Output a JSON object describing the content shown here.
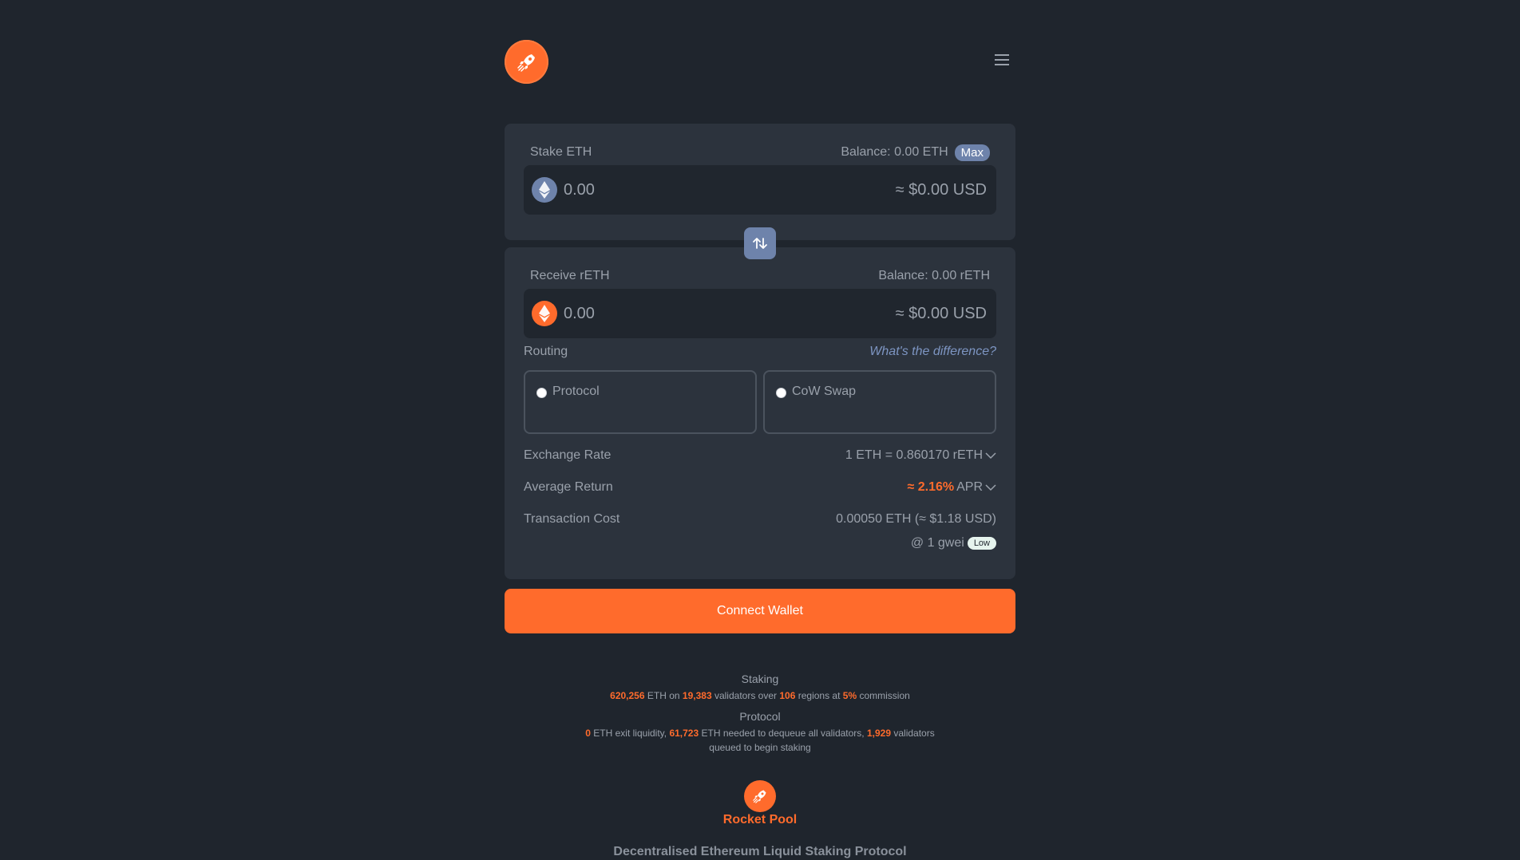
{
  "colors": {
    "background": "#1f252d",
    "card": "#2c333d",
    "accent": "#ff6b2c",
    "eth_blue": "#6e83ab",
    "link": "#7d95c2"
  },
  "header": {
    "logo_icon": "rocket-icon",
    "menu_icon": "hamburger-icon"
  },
  "stake": {
    "label": "Stake ETH",
    "balance": "Balance: 0.00 ETH",
    "max_label": "Max",
    "amount_placeholder": "0.00",
    "usd": "≈ $0.00 USD",
    "coin_icon": "eth-icon"
  },
  "swap": {
    "icon": "swap-arrows-icon"
  },
  "receive": {
    "label": "Receive rETH",
    "balance": "Balance: 0.00 rETH",
    "amount_placeholder": "0.00",
    "usd": "≈ $0.00 USD",
    "coin_icon": "reth-icon"
  },
  "routing": {
    "label": "Routing",
    "link": "What's the difference?",
    "options": [
      {
        "label": "Protocol"
      },
      {
        "label": "CoW Swap"
      }
    ]
  },
  "details": {
    "exchange_rate": {
      "label": "Exchange Rate",
      "value": "1 ETH = 0.860170 rETH"
    },
    "average_return": {
      "label": "Average Return",
      "value_accent": "≈ 2.16%",
      "value_suffix": "APR"
    },
    "transaction_cost": {
      "label": "Transaction Cost",
      "value": "0.00050 ETH (≈ $1.18 USD)"
    },
    "gas": {
      "value": "@ 1 gwei",
      "badge": "Low"
    }
  },
  "connect_button": "Connect Wallet",
  "staking_stats": {
    "title": "Staking",
    "eth": "620,256",
    "t1": "ETH on",
    "validators": "19,383",
    "t2": "validators over",
    "regions": "106",
    "t3": "regions at",
    "commission": "5%",
    "t4": "commission"
  },
  "protocol_stats": {
    "title": "Protocol",
    "exit_liquidity": "0",
    "t1": "ETH exit liquidity,",
    "dequeue": "61,723",
    "t2": "ETH needed to dequeue all validators,",
    "queued": "1,929",
    "t3": "validators queued to begin staking"
  },
  "footer": {
    "brand": "Rocket Pool",
    "tagline": "Decentralised Ethereum Liquid Staking Protocol"
  }
}
